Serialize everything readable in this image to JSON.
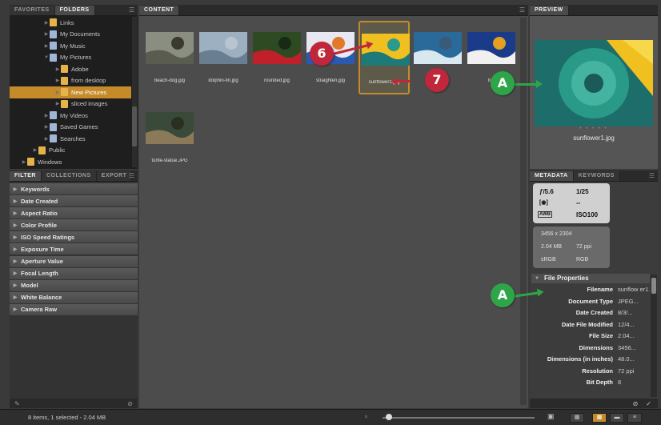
{
  "colors": {
    "accent": "#c58b2a",
    "callout_red": "#c0273a",
    "callout_green": "#2fa54a"
  },
  "folders_panel": {
    "tabs": [
      "FAVORITES",
      "FOLDERS"
    ],
    "active_tab": "FOLDERS",
    "tree": [
      {
        "label": "Links",
        "icon": "folder-icon"
      },
      {
        "label": "My Documents",
        "icon": "doc-folder-icon"
      },
      {
        "label": "My Music",
        "icon": "doc-folder-icon"
      },
      {
        "label": "My Pictures",
        "icon": "doc-folder-icon",
        "expanded": true
      },
      {
        "label": "Adobe",
        "icon": "folder-icon"
      },
      {
        "label": "from desktop",
        "icon": "folder-icon"
      },
      {
        "label": "New Pictures",
        "icon": "folder-icon",
        "selected": true
      },
      {
        "label": "sliced images",
        "icon": "folder-icon"
      },
      {
        "label": "My Videos",
        "icon": "doc-folder-icon"
      },
      {
        "label": "Saved Games",
        "icon": "doc-folder-icon"
      },
      {
        "label": "Searches",
        "icon": "doc-folder-icon"
      },
      {
        "label": "Public",
        "icon": "folder-icon"
      },
      {
        "label": "Windows",
        "icon": "folder-icon"
      }
    ]
  },
  "filter_panel": {
    "tabs": [
      "FILTER",
      "COLLECTIONS",
      "EXPORT"
    ],
    "active_tab": "FILTER",
    "items": [
      "Keywords",
      "Date Created",
      "Aspect Ratio",
      "Color Profile",
      "ISO Speed Ratings",
      "Exposure Time",
      "Aperture Value",
      "Focal Length",
      "Model",
      "White Balance",
      "Camera Raw"
    ]
  },
  "content_panel": {
    "tab": "CONTENT",
    "thumbnails": [
      {
        "name": "beach-dog.jpg",
        "colors": [
          "#8a8e80",
          "#5a5c50",
          "#3a3a30"
        ]
      },
      {
        "name": "dolphin-fin.jpg",
        "colors": [
          "#9db0c2",
          "#6a7e92",
          "#b8c4ce"
        ]
      },
      {
        "name": "rounded.jpg",
        "colors": [
          "#2e4a22",
          "#c0202a",
          "#182a14"
        ]
      },
      {
        "name": "straighten.jpg",
        "colors": [
          "#e8e8f2",
          "#2a5ab0",
          "#e07a2a"
        ]
      },
      {
        "name": "sunflower1.jpg",
        "colors": [
          "#f0c020",
          "#1e7a78",
          "#2a9a8a"
        ],
        "selected": true
      },
      {
        "name": "surf.jpg",
        "colors": [
          "#2a6a9a",
          "#d8e8f0",
          "#3a5a7a"
        ]
      },
      {
        "name": "tr...",
        "colors": [
          "#1a3a8a",
          "#f0f0f0",
          "#e6a020"
        ]
      },
      {
        "name": "turtle-statue.JPG",
        "colors": [
          "#3a4a3a",
          "#8a7a5a",
          "#2a3020"
        ]
      }
    ]
  },
  "preview_panel": {
    "tab": "PREVIEW",
    "filename": "sunflower1.jpg"
  },
  "metadata_panel": {
    "tabs": [
      "METADATA",
      "KEYWORDS"
    ],
    "active_tab": "METADATA",
    "camera": {
      "aperture": "ƒ/5.6",
      "shutter": "1/25",
      "metering": "--",
      "iso": "ISO100",
      "wb": "AWB"
    },
    "file_info": {
      "dimensions": "3456 x 2304",
      "size": "2.04 MB",
      "ppi": "72 ppi",
      "colorspace": "sRGB",
      "mode": "RGB"
    },
    "section_title": "File Properties",
    "properties": [
      {
        "key": "Filename",
        "value": "sunflow er1.jpg"
      },
      {
        "key": "Document Type",
        "value": "JPEG..."
      },
      {
        "key": "Date Created",
        "value": "8/3/..."
      },
      {
        "key": "Date File Modified",
        "value": "12/4..."
      },
      {
        "key": "File Size",
        "value": "2.04..."
      },
      {
        "key": "Dimensions",
        "value": "3456..."
      },
      {
        "key": "Dimensions (in inches)",
        "value": "48.0..."
      },
      {
        "key": "Resolution",
        "value": "72 ppi"
      },
      {
        "key": "Bit Depth",
        "value": "8"
      }
    ]
  },
  "status_bar": {
    "text": "8 items, 1 selected - 2.04 MB"
  },
  "callouts": [
    "6",
    "7",
    "A",
    "A"
  ]
}
